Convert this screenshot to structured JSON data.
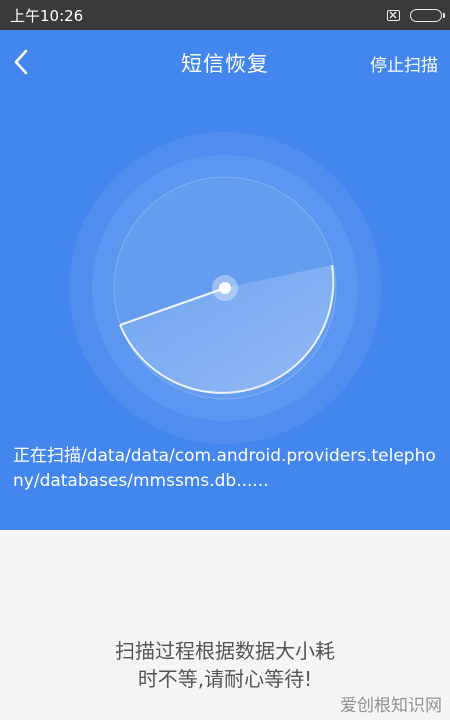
{
  "status_bar": {
    "time": "上午10:26"
  },
  "header": {
    "title": "短信恢复",
    "back_icon": "chevron-left-icon",
    "stop_scan_label": "停止扫描"
  },
  "scan": {
    "status_line": "正在扫描/data/data/com.android.providers.telephony/databases/mmssms.db......"
  },
  "hint": {
    "line1": "扫描过程根据数据大小耗",
    "line2": "时不等,请耐心等待!"
  },
  "watermark": "爱创根知识网",
  "colors": {
    "primary_blue": "#4286ee",
    "status_bar": "#3a3a3a",
    "background": "#f5f5f5",
    "hint_text": "#555555"
  }
}
